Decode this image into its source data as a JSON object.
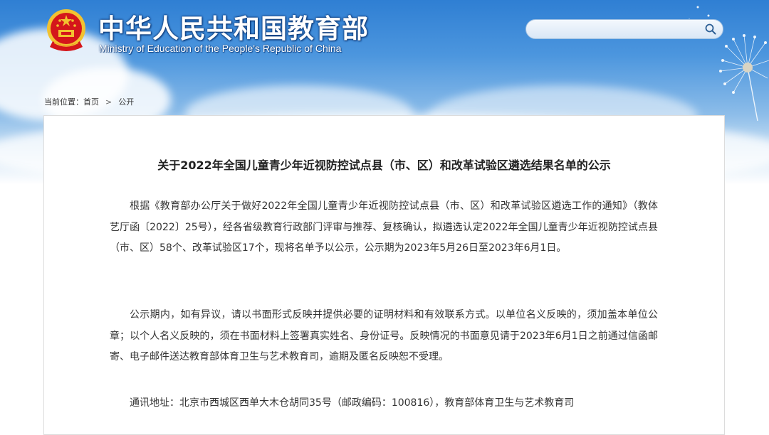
{
  "header": {
    "title_cn": "中华人民共和国教育部",
    "title_en": "Ministry of Education of the People's Republic of China",
    "search": {
      "placeholder": "",
      "icon": "search-icon"
    }
  },
  "breadcrumb": {
    "prefix": "当前位置：",
    "items": [
      "首页",
      "公开"
    ],
    "separator": ">"
  },
  "article": {
    "title": "关于2022年全国儿童青少年近视防控试点县（市、区）和改革试验区遴选结果名单的公示",
    "paragraphs": [
      "根据《教育部办公厅关于做好2022年全国儿童青少年近视防控试点县（市、区）和改革试验区遴选工作的通知》（教体艺厅函〔2022〕25号），经各省级教育行政部门评审与推荐、复核确认，拟遴选认定2022年全国儿童青少年近视防控试点县（市、区）58个、改革试验区17个，现将名单予以公示，公示期为2023年5月26日至2023年6月1日。",
      "公示期内，如有异议，请以书面形式反映并提供必要的证明材料和有效联系方式。以单位名义反映的，须加盖本单位公章；以个人名义反映的，须在书面材料上签署真实姓名、身份证号。反映情况的书面意见请于2023年6月1日之前通过信函邮寄、电子邮件送达教育部体育卫生与艺术教育司，逾期及匿名反映恕不受理。",
      "通讯地址：北京市西城区西单大木仓胡同35号（邮政编码：100816），教育部体育卫生与艺术教育司"
    ]
  },
  "colors": {
    "sky_top": "#2f7fd3",
    "title_text": "#222222",
    "body_text": "#333333",
    "emblem_red": "#d4161b",
    "emblem_gold": "#f2c230"
  }
}
